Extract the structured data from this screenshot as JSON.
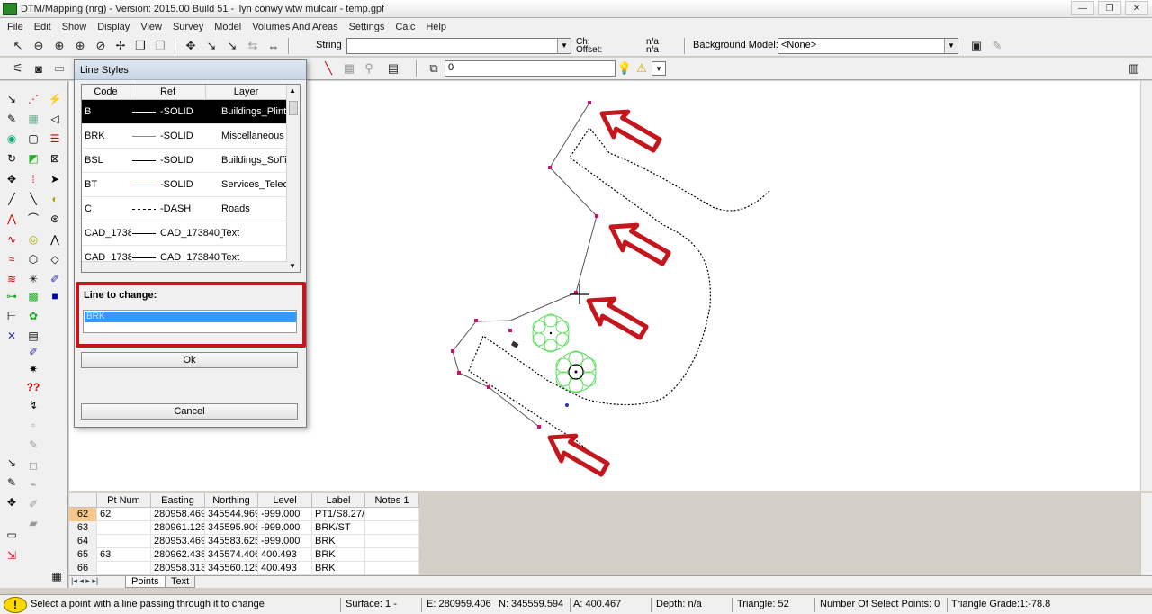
{
  "window": {
    "title": "DTM/Mapping (nrg) - Version: 2015.00 Build 51 - llyn conwy wtw mulcair - temp.gpf",
    "controls": [
      "—",
      "❐",
      "✕"
    ]
  },
  "menu": [
    "File",
    "Edit",
    "Show",
    "Display",
    "View",
    "Survey",
    "Model",
    "Volumes And Areas",
    "Settings",
    "Calc",
    "Help"
  ],
  "toolbar": {
    "string_label": "String",
    "string_value": "",
    "ch_label": "Ch:",
    "offset_label": "Offset:",
    "ch_value": "n/a",
    "offset_value": "n/a",
    "background_model_label": "Background Model:",
    "background_model_value": "<None>",
    "layer_value": "0"
  },
  "dialog": {
    "title": "Line Styles",
    "columns": [
      "Code",
      "Ref",
      "Layer"
    ],
    "rows": [
      {
        "code": "B",
        "ref": "-SOLID",
        "layer": "Buildings_Plint",
        "style": "solid",
        "selected": true
      },
      {
        "code": "BRK",
        "ref": "-SOLID",
        "layer": "Miscellaneous",
        "style": "solid-light"
      },
      {
        "code": "BSL",
        "ref": "-SOLID",
        "layer": "Buildings_Soffi",
        "style": "solid"
      },
      {
        "code": "BT",
        "ref": "-SOLID",
        "layer": "Services_Telec",
        "style": "solid-cyan"
      },
      {
        "code": "C",
        "ref": "-DASH",
        "layer": "Roads",
        "style": "dash"
      },
      {
        "code": "CAD_1738",
        "ref": "CAD_173840_",
        "layer": "Text",
        "style": "solid"
      },
      {
        "code": "CAD_1738",
        "ref": "CAD_173840_",
        "layer": "Text",
        "style": "solid"
      }
    ],
    "line_to_change_label": "Line to change:",
    "line_to_change_value": "BRK",
    "ok_label": "Ok",
    "cancel_label": "Cancel"
  },
  "grid": {
    "columns": [
      "Pt Num",
      "Easting",
      "Northing",
      "Level",
      "Label",
      "Notes 1"
    ],
    "rows": [
      {
        "row": "62",
        "pt": "62",
        "easting": "280958.469",
        "northing": "345544.969",
        "level": "-999.000",
        "label": "PT1/S8.27/F",
        "notes": "",
        "active": true
      },
      {
        "row": "63",
        "pt": "",
        "easting": "280961.125",
        "northing": "345595.906",
        "level": "-999.000",
        "label": "BRK/ST",
        "notes": ""
      },
      {
        "row": "64",
        "pt": "",
        "easting": "280953.469",
        "northing": "345583.625",
        "level": "-999.000",
        "label": "BRK",
        "notes": ""
      },
      {
        "row": "65",
        "pt": "63",
        "easting": "280962.438",
        "northing": "345574.406",
        "level": "400.493",
        "label": "BRK",
        "notes": ""
      },
      {
        "row": "66",
        "pt": "",
        "easting": "280958.313",
        "northing": "345560.125",
        "level": "400.493",
        "label": "BRK",
        "notes": ""
      }
    ],
    "tabs": [
      "Points",
      "Text"
    ]
  },
  "status": {
    "message": "Select a point with a line passing through it to change",
    "surface": "Surface: 1 -",
    "easting": "E: 280959.406",
    "northing": "N: 345559.594",
    "alt": "A: 400.467",
    "depth": "Depth: n/a",
    "triangle": "Triangle: 52",
    "select_points": "Number Of Select Points: 0",
    "triangle_grade": "Triangle Grade:1:-78.8"
  },
  "colors": {
    "annotation_red": "#c4161c",
    "tree_green": "#5de05d",
    "point_magenta": "#d0106a",
    "selection_blue": "#3399ff"
  }
}
